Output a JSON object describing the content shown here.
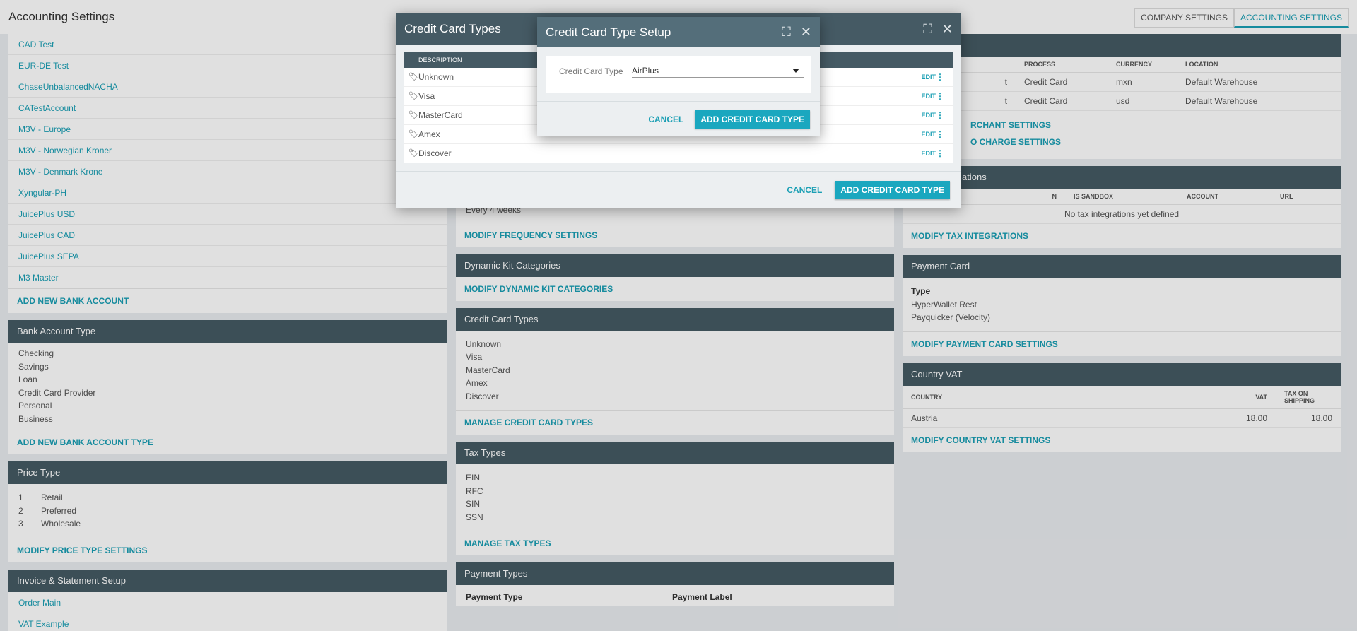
{
  "header": {
    "title": "Accounting Settings",
    "tabs": [
      {
        "label": "COMPANY SETTINGS"
      },
      {
        "label": "ACCOUNTING SETTINGS"
      }
    ]
  },
  "left": {
    "bank_accounts": [
      "CAD Test",
      "EUR-DE Test",
      "ChaseUnbalancedNACHA",
      "CATestAccount",
      "M3V - Europe",
      "M3V - Norwegian Kroner",
      "M3V - Denmark Krone",
      "Xyngular-PH",
      "JuicePlus USD",
      "JuicePlus CAD",
      "JuicePlus SEPA",
      "M3 Master"
    ],
    "add_bank_account": "ADD NEW BANK ACCOUNT",
    "bank_account_type": {
      "title": "Bank Account Type",
      "items": [
        "Checking",
        "Savings",
        "Loan",
        "Credit Card Provider",
        "Personal",
        "Business"
      ],
      "action": "ADD NEW BANK ACCOUNT TYPE"
    },
    "price_type": {
      "title": "Price Type",
      "items": [
        {
          "num": "1",
          "name": "Retail"
        },
        {
          "num": "2",
          "name": "Preferred"
        },
        {
          "num": "3",
          "name": "Wholesale"
        }
      ],
      "action": "MODIFY PRICE TYPE SETTINGS"
    },
    "invoice": {
      "title": "Invoice & Statement Setup",
      "items": [
        "Order Main",
        "VAT Example"
      ]
    }
  },
  "mid": {
    "frequency": {
      "value": "Every 4 weeks",
      "action": "MODIFY FREQUENCY SETTINGS"
    },
    "dynamic_kit": {
      "title": "Dynamic Kit Categories",
      "action": "MODIFY DYNAMIC KIT CATEGORIES"
    },
    "credit_card_types": {
      "title": "Credit Card Types",
      "items": [
        "Unknown",
        "Visa",
        "MasterCard",
        "Amex",
        "Discover"
      ],
      "action": "MANAGE CREDIT CARD TYPES"
    },
    "tax_types": {
      "title": "Tax Types",
      "items": [
        "EIN",
        "RFC",
        "SIN",
        "SSN"
      ],
      "action": "MANAGE TAX TYPES"
    },
    "payment_types": {
      "title": "Payment Types",
      "col1": "Payment Type",
      "col2": "Payment Label"
    }
  },
  "right": {
    "merchant": {
      "headers": [
        "PROCESS",
        "CURRENCY",
        "LOCATION"
      ],
      "rows": [
        {
          "name_frag": "t",
          "process": "Credit Card",
          "currency": "mxn",
          "location": "Default Warehouse"
        },
        {
          "name_frag": "t",
          "process": "Credit Card",
          "currency": "usd",
          "location": "Default Warehouse"
        }
      ],
      "action1": "RCHANT SETTINGS",
      "action2": "O CHARGE SETTINGS"
    },
    "tax_integrations": {
      "title_frag": "ations",
      "headers": [
        "N",
        "IS SANDBOX",
        "ACCOUNT",
        "URL"
      ],
      "empty": "No tax integrations yet defined",
      "action": "MODIFY TAX INTEGRATIONS"
    },
    "payment_card": {
      "title": "Payment Card",
      "label": "Type",
      "items": [
        "HyperWallet Rest",
        "Payquicker (Velocity)"
      ],
      "action": "MODIFY PAYMENT CARD SETTINGS"
    },
    "country_vat": {
      "title": "Country VAT",
      "headers": [
        "COUNTRY",
        "VAT",
        "TAX ON SHIPPING"
      ],
      "rows": [
        {
          "country": "Austria",
          "vat": "18.00",
          "shipping": "18.00"
        }
      ],
      "action": "MODIFY COUNTRY VAT SETTINGS"
    }
  },
  "modal_types": {
    "title": "Credit Card Types",
    "column": "DESCRIPTION",
    "rows": [
      "Unknown",
      "Visa",
      "MasterCard",
      "Amex",
      "Discover"
    ],
    "edit_label": "EDIT",
    "cancel": "CANCEL",
    "add": "ADD CREDIT CARD TYPE"
  },
  "modal_setup": {
    "title": "Credit Card Type Setup",
    "field_label": "Credit Card Type",
    "field_value": "AirPlus",
    "cancel": "CANCEL",
    "add": "ADD CREDIT CARD TYPE"
  },
  "colors": {
    "accent": "#1a9fb4",
    "header_dark": "#455a64",
    "button": "#1aa7bf"
  }
}
